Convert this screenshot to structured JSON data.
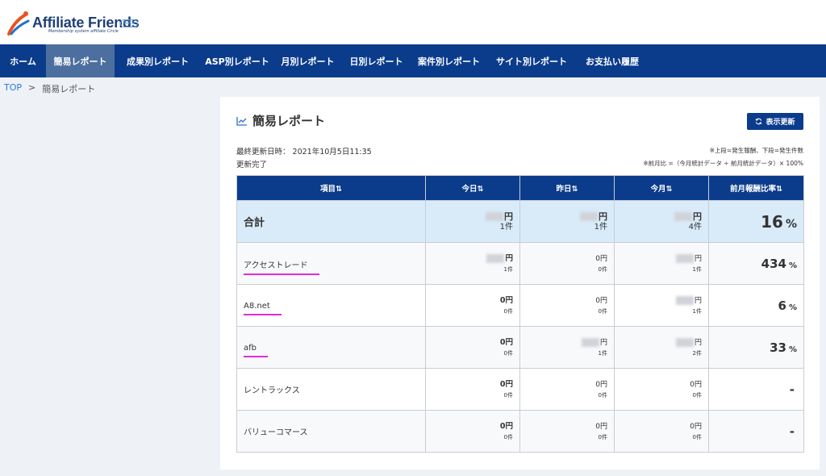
{
  "header": {
    "logo_title": "Affiliate Friends",
    "logo_subtitle": "Membership system affiliate Circle",
    "logo_badge": "Beta"
  },
  "nav": {
    "items": [
      {
        "label": "ホーム",
        "active": false
      },
      {
        "label": "簡易レポート",
        "active": true
      },
      {
        "label": "成果別レポート",
        "active": false
      },
      {
        "label": "ASP別レポート",
        "active": false
      },
      {
        "label": "月別レポート",
        "active": false
      },
      {
        "label": "日別レポート",
        "active": false
      },
      {
        "label": "案件別レポート",
        "active": false
      },
      {
        "label": "サイト別レポート",
        "active": false
      },
      {
        "label": "お支払い履歴",
        "active": false
      }
    ]
  },
  "breadcrumb": {
    "top": "TOP",
    "separator": ">",
    "current": "簡易レポート"
  },
  "panel": {
    "title": "簡易レポート",
    "refresh_label": "表示更新",
    "last_updated": "最終更新日時： 2021年10月5日11:35",
    "status": "更新完了",
    "note1": "※上段=発生報酬、下段=発生件数",
    "note2": "※前月比 =（今月統計データ ÷ 前月統計データ）× 100%"
  },
  "table": {
    "headers": {
      "item": "項目⇅",
      "today": "今日⇅",
      "yesterday": "昨日⇅",
      "month": "今月⇅",
      "ratio": "前月報酬比率⇅"
    },
    "rows": [
      {
        "name": "合計",
        "today": {
          "amount": "円",
          "count": "1件"
        },
        "yesterday": {
          "amount": "円",
          "count": "1件"
        },
        "month": {
          "amount": "円",
          "count": "4件"
        },
        "ratio": "16",
        "ratio_unit": "%"
      },
      {
        "name": "アクセストレード",
        "today": {
          "amount": "円",
          "count": "1件"
        },
        "yesterday": {
          "amount": "0円",
          "count": "0件"
        },
        "month": {
          "amount": "円",
          "count": "1件"
        },
        "ratio": "434",
        "ratio_unit": "%"
      },
      {
        "name": "A8.net",
        "today": {
          "amount": "0円",
          "count": "0件"
        },
        "yesterday": {
          "amount": "0円",
          "count": "0件"
        },
        "month": {
          "amount": "円",
          "count": "1件"
        },
        "ratio": "6",
        "ratio_unit": "%"
      },
      {
        "name": "afb",
        "today": {
          "amount": "0円",
          "count": "0件"
        },
        "yesterday": {
          "amount": "円",
          "count": "1件"
        },
        "month": {
          "amount": "円",
          "count": "2件"
        },
        "ratio": "33",
        "ratio_unit": "%"
      },
      {
        "name": "レントラックス",
        "today": {
          "amount": "0円",
          "count": "0件"
        },
        "yesterday": {
          "amount": "0円",
          "count": "0件"
        },
        "month": {
          "amount": "0円",
          "count": "0件"
        },
        "ratio": "-",
        "ratio_unit": ""
      },
      {
        "name": "バリューコマース",
        "today": {
          "amount": "0円",
          "count": "0件"
        },
        "yesterday": {
          "amount": "0円",
          "count": "0件"
        },
        "month": {
          "amount": "0円",
          "count": "0件"
        },
        "ratio": "-",
        "ratio_unit": ""
      }
    ]
  }
}
